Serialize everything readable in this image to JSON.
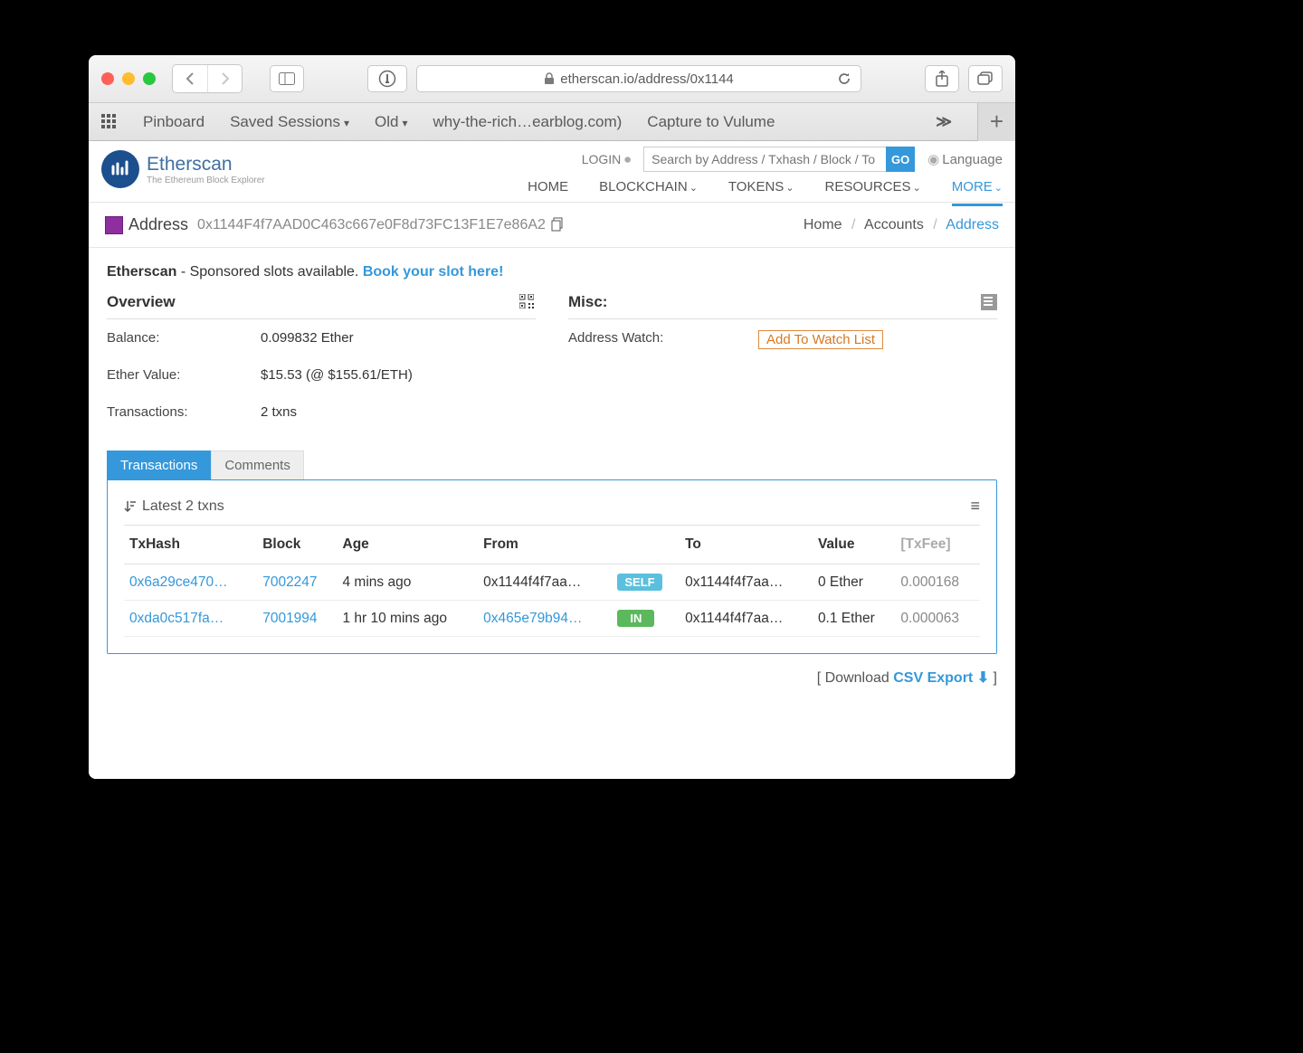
{
  "browser": {
    "url_display": "etherscan.io/address/0x1144",
    "bookmarks": [
      "Pinboard",
      "Saved Sessions",
      "Old",
      "why-the-rich…earblog.com)",
      "Capture to Vulume"
    ]
  },
  "header": {
    "brand": "Etherscan",
    "tagline": "The Ethereum Block Explorer",
    "login": "LOGIN",
    "search_placeholder": "Search by Address / Txhash / Block / To",
    "go": "GO",
    "language": "Language",
    "nav": [
      "HOME",
      "BLOCKCHAIN",
      "TOKENS",
      "RESOURCES",
      "MORE"
    ]
  },
  "address_row": {
    "label": "Address",
    "hash": "0x1144F4f7AAD0C463c667e0F8d73FC13F1E7e86A2",
    "breadcrumb": {
      "home": "Home",
      "accounts": "Accounts",
      "current": "Address"
    }
  },
  "sponsor": {
    "brand": "Etherscan",
    "text": " - Sponsored slots available. ",
    "link": "Book your slot here!"
  },
  "overview": {
    "title": "Overview",
    "balance_k": "Balance:",
    "balance_v": "0.099832 Ether",
    "value_k": "Ether Value:",
    "value_v": "$15.53 (@ $155.61/ETH)",
    "txns_k": "Transactions:",
    "txns_v": "2 txns"
  },
  "misc": {
    "title": "Misc:",
    "watch_k": "Address Watch:",
    "watch_btn": "Add To Watch List"
  },
  "tabs": {
    "transactions": "Transactions",
    "comments": "Comments"
  },
  "tx_panel": {
    "latest": "Latest 2 txns",
    "columns": [
      "TxHash",
      "Block",
      "Age",
      "From",
      "",
      "To",
      "Value",
      "[TxFee]"
    ],
    "rows": [
      {
        "hash": "0x6a29ce470…",
        "block": "7002247",
        "age": "4 mins ago",
        "from": "0x1144f4f7aa…",
        "from_link": false,
        "dir": "SELF",
        "to": "0x1144f4f7aa…",
        "value": "0 Ether",
        "fee": "0.000168"
      },
      {
        "hash": "0xda0c517fa…",
        "block": "7001994",
        "age": "1 hr 10 mins ago",
        "from": "0x465e79b94…",
        "from_link": true,
        "dir": "IN",
        "to": "0x1144f4f7aa…",
        "value": "0.1 Ether",
        "fee": "0.000063"
      }
    ]
  },
  "download": {
    "prefix": "[ Download ",
    "link": "CSV Export",
    "suffix": " ]"
  }
}
